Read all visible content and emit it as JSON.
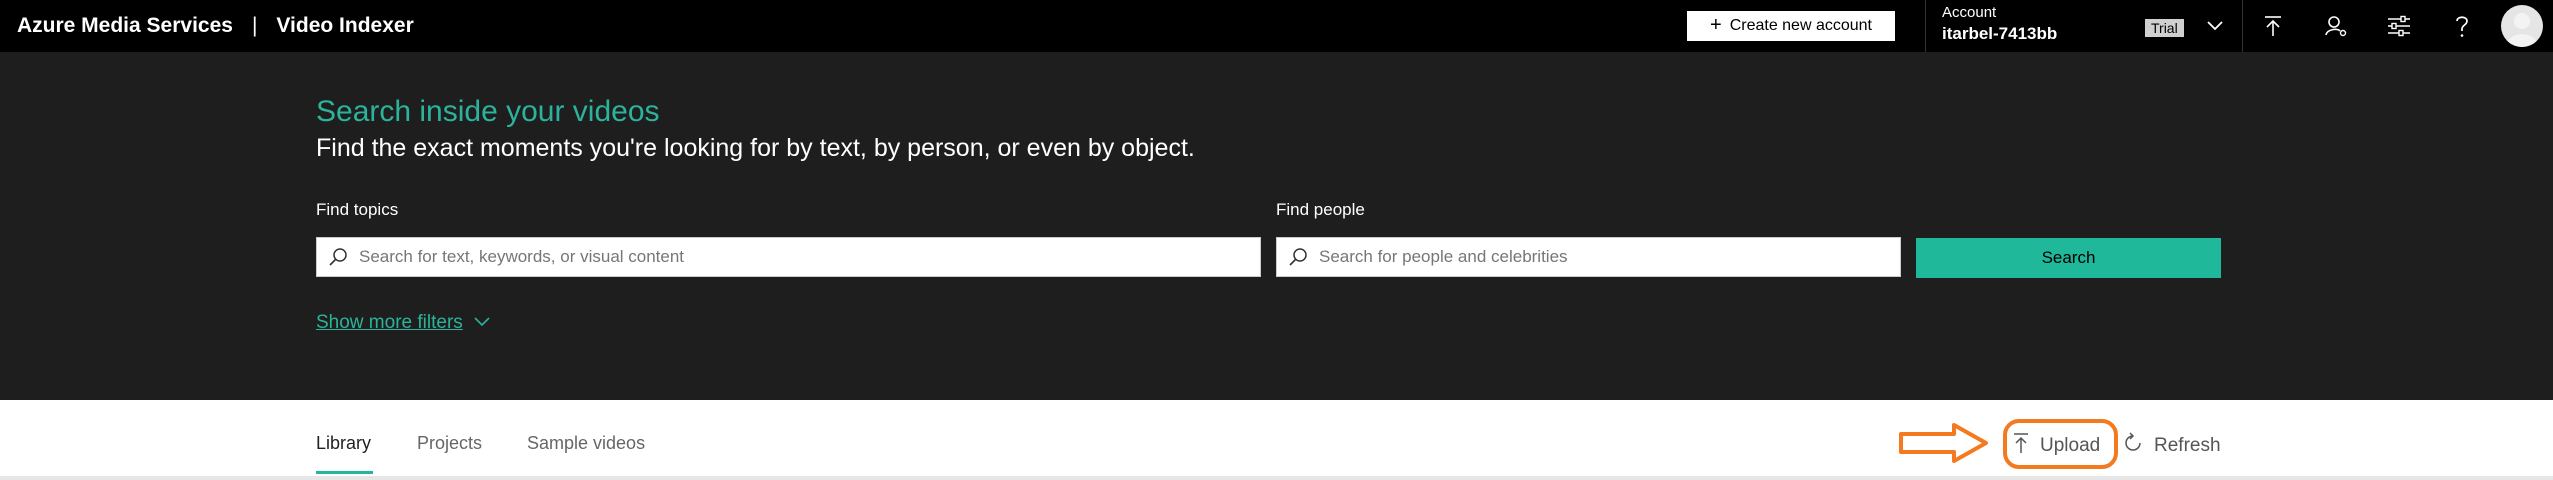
{
  "header": {
    "brand_primary": "Azure Media Services",
    "brand_separator": "|",
    "brand_secondary": "Video Indexer",
    "create_account_label": "Create new account",
    "account_label": "Account",
    "account_name": "itarbel-7413bb",
    "trial_badge": "Trial",
    "icons": [
      "plus-icon",
      "chevron-down-icon",
      "upload-icon",
      "user-settings-icon",
      "sliders-icon",
      "help-icon",
      "avatar"
    ]
  },
  "hero": {
    "title": "Search inside your videos",
    "subtitle": "Find the exact moments you're looking for by text, by person, or even by object.",
    "topics_label": "Find topics",
    "topics_placeholder": "Search for text, keywords, or visual content",
    "people_label": "Find people",
    "people_placeholder": "Search for people and celebrities",
    "search_button": "Search",
    "more_filters": "Show more filters"
  },
  "tabs": [
    {
      "label": "Library",
      "active": true
    },
    {
      "label": "Projects",
      "active": false
    },
    {
      "label": "Sample videos",
      "active": false
    }
  ],
  "actions": {
    "upload_label": "Upload",
    "refresh_label": "Refresh"
  },
  "colors": {
    "accent": "#1fb89b",
    "annotation": "#f47a20",
    "hero_bg": "#1e1e1e",
    "topbar_bg": "#000000"
  }
}
